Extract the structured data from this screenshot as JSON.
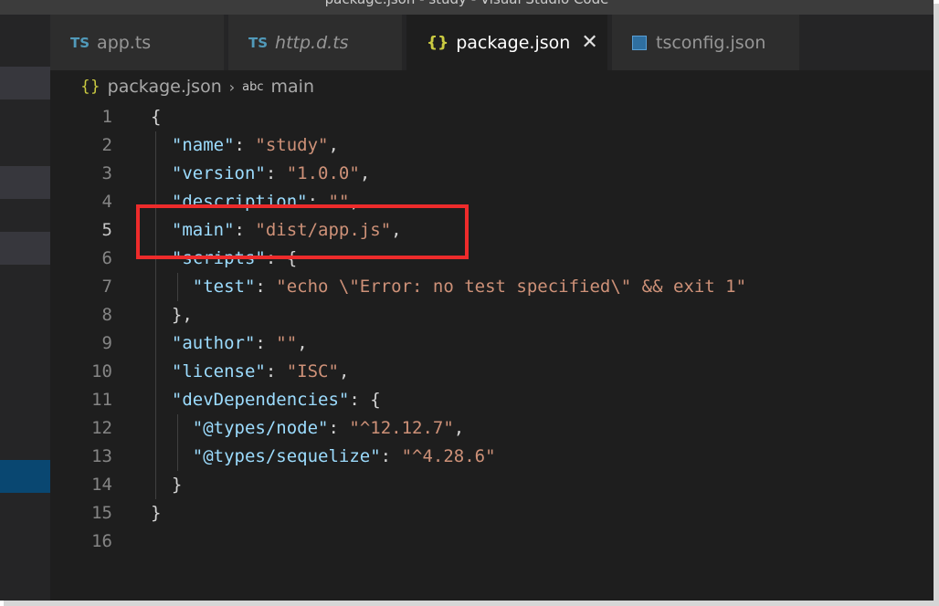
{
  "window": {
    "title": "package.json - study - Visual Studio Code"
  },
  "tabs": [
    {
      "icon": "ts-file-icon",
      "badge": "TS",
      "label": "app.ts",
      "active": false,
      "italic": false
    },
    {
      "icon": "ts-file-icon",
      "badge": "TS",
      "label": "http.d.ts",
      "active": false,
      "italic": true
    },
    {
      "icon": "json-file-icon",
      "badge": "{}",
      "label": "package.json",
      "active": true,
      "italic": false
    },
    {
      "icon": "tsconfig-file-icon",
      "badge": "",
      "label": "tsconfig.json",
      "active": false,
      "italic": false
    }
  ],
  "breadcrumb": {
    "file_badge": "{}",
    "file": "package.json",
    "separator": "›",
    "symbol_badge": "abc",
    "symbol": "main"
  },
  "editor": {
    "current_line": 5,
    "highlighted_line": 5,
    "lines": [
      {
        "n": "1",
        "text": "{"
      },
      {
        "n": "2",
        "text": "  \"name\": \"study\","
      },
      {
        "n": "3",
        "text": "  \"version\": \"1.0.0\","
      },
      {
        "n": "4",
        "text": "  \"description\": \"\","
      },
      {
        "n": "5",
        "text": "  \"main\": \"dist/app.js\","
      },
      {
        "n": "6",
        "text": "  \"scripts\": {"
      },
      {
        "n": "7",
        "text": "    \"test\": \"echo \\\"Error: no test specified\\\" && exit 1\""
      },
      {
        "n": "8",
        "text": "  },"
      },
      {
        "n": "9",
        "text": "  \"author\": \"\","
      },
      {
        "n": "10",
        "text": "  \"license\": \"ISC\","
      },
      {
        "n": "11",
        "text": "  \"devDependencies\": {"
      },
      {
        "n": "12",
        "text": "    \"@types/node\": \"^12.12.7\","
      },
      {
        "n": "13",
        "text": "    \"@types/sequelize\": \"^4.28.6\""
      },
      {
        "n": "14",
        "text": "  }"
      },
      {
        "n": "15",
        "text": "}"
      },
      {
        "n": "16",
        "text": ""
      }
    ]
  },
  "colors": {
    "editor_bg": "#1e1e1e",
    "key": "#9cdcfe",
    "string": "#ce9178",
    "highlight_box": "#ee2b2b"
  }
}
